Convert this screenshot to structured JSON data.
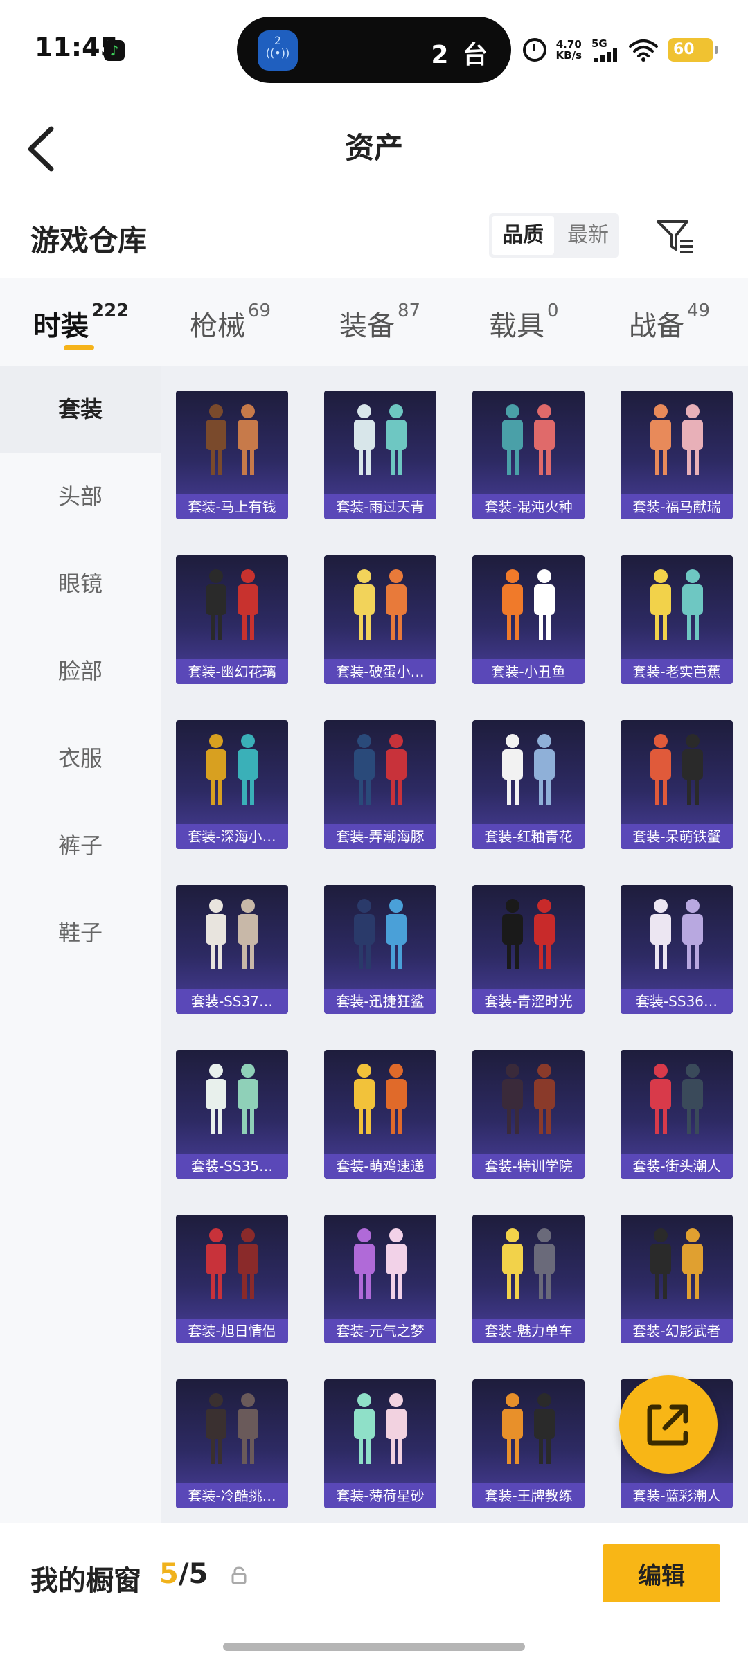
{
  "status_bar": {
    "time": "11:45",
    "island_icon_text": "2",
    "island_text": "2 台",
    "net_speed_value": "4.70",
    "net_speed_unit": "KB/s",
    "network_type": "5G",
    "battery": "60",
    "battery_color": "#f0c231"
  },
  "header": {
    "title": "资产",
    "back_icon": "chevron-left-icon"
  },
  "warehouse": {
    "title": "游戏仓库",
    "sort_options": [
      "品质",
      "最新"
    ],
    "sort_selected": "品质",
    "filter_icon": "filter-icon"
  },
  "tabs": [
    {
      "label": "时装",
      "count": "222",
      "active": true
    },
    {
      "label": "枪械",
      "count": "69",
      "active": false
    },
    {
      "label": "装备",
      "count": "87",
      "active": false
    },
    {
      "label": "载具",
      "count": "0",
      "active": false
    },
    {
      "label": "战备",
      "count": "49",
      "active": false
    }
  ],
  "side_nav": [
    {
      "label": "套装",
      "active": true
    },
    {
      "label": "头部",
      "active": false
    },
    {
      "label": "眼镜",
      "active": false
    },
    {
      "label": "脸部",
      "active": false
    },
    {
      "label": "衣服",
      "active": false
    },
    {
      "label": "裤子",
      "active": false
    },
    {
      "label": "鞋子",
      "active": false
    }
  ],
  "items": [
    {
      "label": "套装-马上有钱",
      "figure": "brown-single-figure"
    },
    {
      "label": "套装-雨过天青",
      "figure": "white-teal-pair"
    },
    {
      "label": "套装-混沌火种",
      "figure": "teal-colorful-pair"
    },
    {
      "label": "套装-福马献瑞",
      "figure": "orange-pink-pair"
    },
    {
      "label": "套装-幽幻花璃",
      "figure": "black-red-pair"
    },
    {
      "label": "套装-破蛋小…",
      "figure": "chick-costume"
    },
    {
      "label": "套装-小丑鱼",
      "figure": "clownfish-costume"
    },
    {
      "label": "套装-老实芭蕉",
      "figure": "banana-costume-pair"
    },
    {
      "label": "套装-深海小…",
      "figure": "diver-pair"
    },
    {
      "label": "套装-弄潮海豚",
      "figure": "blue-red-outfit"
    },
    {
      "label": "套装-红釉青花",
      "figure": "white-blue-pair"
    },
    {
      "label": "套装-呆萌铁蟹",
      "figure": "crab-outfit"
    },
    {
      "label": "套装-SS37…",
      "figure": "white-clothes-set"
    },
    {
      "label": "套装-迅捷狂鲨",
      "figure": "shark-outfit"
    },
    {
      "label": "套装-青涩时光",
      "figure": "black-red-uniform"
    },
    {
      "label": "套装-SS36…",
      "figure": "lilac-clothes-set"
    },
    {
      "label": "套装-SS35…",
      "figure": "mint-clothes-set"
    },
    {
      "label": "套装-萌鸡速递",
      "figure": "yellow-chicken-pair"
    },
    {
      "label": "套装-特训学院",
      "figure": "academy-uniform"
    },
    {
      "label": "套装-街头潮人",
      "figure": "red-puffer-set"
    },
    {
      "label": "套装-旭日情侣",
      "figure": "red-hoodie-set"
    },
    {
      "label": "套装-元气之梦",
      "figure": "purple-pair"
    },
    {
      "label": "套装-魅力单车",
      "figure": "yellow-shirt-set"
    },
    {
      "label": "套装-幻影武者",
      "figure": "masked-warrior"
    },
    {
      "label": "套装-冷酷挑…",
      "figure": "dark-hooded-set"
    },
    {
      "label": "套装-薄荷星砂",
      "figure": "mint-pair"
    },
    {
      "label": "套装-王牌教练",
      "figure": "orange-coach-set"
    },
    {
      "label": "套装-蓝彩潮人",
      "figure": "blue-outfit"
    }
  ],
  "fab_icon": "share-external-icon",
  "bottom_bar": {
    "label": "我的橱窗",
    "count_current": "5",
    "count_sep": "/5",
    "lock_icon": "lock-icon",
    "edit_label": "编辑",
    "accent_color": "#f8b616"
  }
}
